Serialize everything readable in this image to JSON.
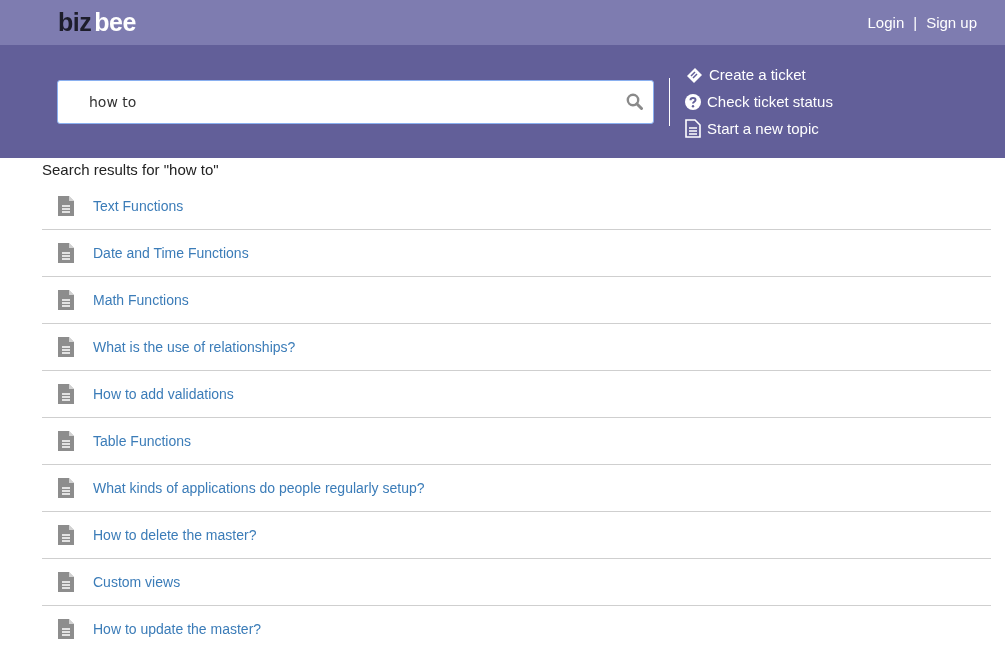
{
  "logo": {
    "part_1": "biz",
    "part_2": "bee"
  },
  "auth": {
    "login": "Login",
    "separator": "|",
    "signup": "Sign up"
  },
  "search": {
    "value": "how to"
  },
  "actions": [
    {
      "kind": "ticket",
      "label": "Create a ticket"
    },
    {
      "kind": "status",
      "label": "Check ticket status"
    },
    {
      "kind": "topic",
      "label": "Start a new topic"
    }
  ],
  "results_heading": "Search results for \"how to\"",
  "results": [
    "Text Functions",
    "Date and Time Functions",
    "Math Functions",
    "What is the use of relationships?",
    "How to add validations",
    "Table Functions",
    "What kinds of applications do people regularly setup?",
    "How to delete the master?",
    "Custom views",
    "How to update the master?"
  ]
}
